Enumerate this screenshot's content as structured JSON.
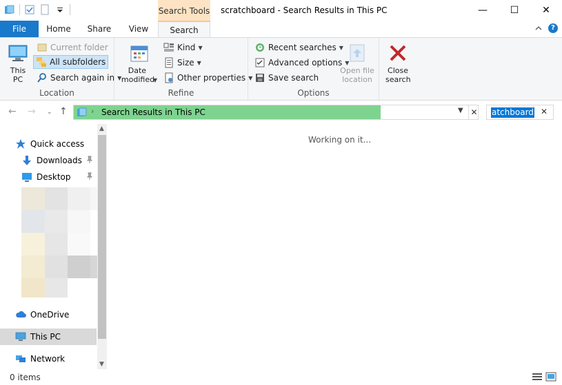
{
  "window": {
    "title": "scratchboard - Search Results in This PC",
    "context_tab_group": "Search Tools",
    "buttons": {
      "minimize": "—",
      "maximize": "☐",
      "close": "✕"
    }
  },
  "ribbon_tabs": {
    "file": "File",
    "home": "Home",
    "share": "Share",
    "view": "View",
    "search": "Search"
  },
  "ribbon": {
    "location": {
      "label": "Location",
      "this_pc": "This PC",
      "current_folder": "Current folder",
      "all_subfolders": "All subfolders",
      "search_again_in": "Search again in"
    },
    "refine": {
      "label": "Refine",
      "date_modified": "Date modified",
      "kind": "Kind",
      "size": "Size",
      "other_properties": "Other properties"
    },
    "options": {
      "label": "Options",
      "recent_searches": "Recent searches",
      "advanced_options": "Advanced options",
      "save_search": "Save search",
      "open_file_location": "Open file location"
    },
    "close": {
      "close_search": "Close search"
    }
  },
  "address": {
    "path": "Search Results in This PC",
    "progress": 0.76
  },
  "search": {
    "query": "atchboard"
  },
  "nav": {
    "quick_access": "Quick access",
    "downloads": "Downloads",
    "desktop": "Desktop",
    "onedrive": "OneDrive",
    "this_pc": "This PC",
    "network": "Network"
  },
  "main": {
    "status_message": "Working on it..."
  },
  "status": {
    "items": "0 items"
  },
  "colors": {
    "accent": "#1979ca",
    "context_tab": "#fde3c4",
    "progress": "#7ed48f",
    "selection": "#0078d7"
  }
}
